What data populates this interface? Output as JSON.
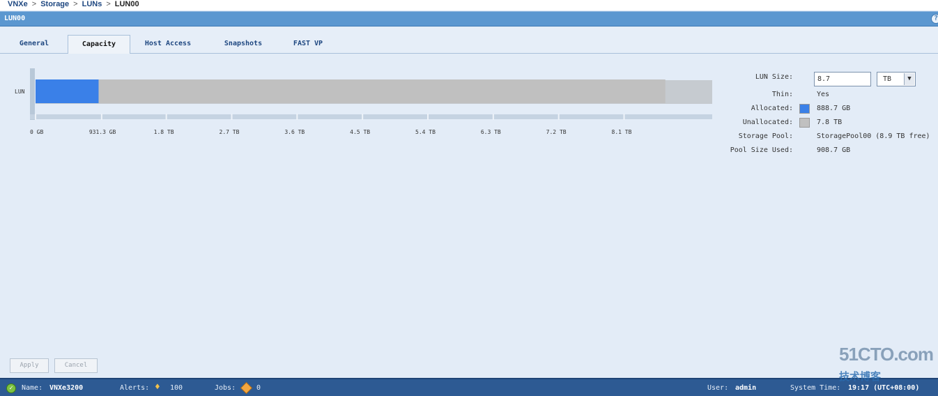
{
  "breadcrumb": {
    "items": [
      "VNXe",
      "Storage",
      "LUNs"
    ],
    "current": "LUN00",
    "separator": ">"
  },
  "window": {
    "title": "LUN00",
    "help_icon": "help-icon"
  },
  "tabs": [
    {
      "label": "General",
      "active": false
    },
    {
      "label": "Capacity",
      "active": true
    },
    {
      "label": "Host Access",
      "active": false
    },
    {
      "label": "Snapshots",
      "active": false
    },
    {
      "label": "FAST VP",
      "active": false
    }
  ],
  "chart_data": {
    "type": "bar",
    "orientation": "horizontal",
    "stacked": true,
    "categories": [
      "LUN"
    ],
    "series": [
      {
        "name": "Allocated",
        "values": [
          888.7
        ],
        "color": "#3a80e8"
      },
      {
        "name": "Unallocated",
        "values": [
          7987.3
        ],
        "color": "#c0c0c0"
      }
    ],
    "units": "GB",
    "xlim": [
      0,
      9536.7
    ],
    "ticks": [
      {
        "value": 0,
        "label": "0 GB"
      },
      {
        "value": 931.3,
        "label": "931.3 GB"
      },
      {
        "value": 1843.2,
        "label": "1.8 TB"
      },
      {
        "value": 2764.8,
        "label": "2.7 TB"
      },
      {
        "value": 3686.4,
        "label": "3.6 TB"
      },
      {
        "value": 4608,
        "label": "4.5 TB"
      },
      {
        "value": 5529.6,
        "label": "5.4 TB"
      },
      {
        "value": 6451.2,
        "label": "6.3 TB"
      },
      {
        "value": 7372.8,
        "label": "7.2 TB"
      },
      {
        "value": 8294.4,
        "label": "8.1 TB"
      }
    ],
    "grid": false
  },
  "properties": {
    "lun_size_label": "LUN Size:",
    "lun_size_value": "8.7",
    "lun_size_unit": "TB",
    "thin_label": "Thin:",
    "thin_value": "Yes",
    "allocated_label": "Allocated:",
    "allocated_value": "888.7 GB",
    "unallocated_label": "Unallocated:",
    "unallocated_value": "7.8 TB",
    "storage_pool_label": "Storage Pool:",
    "storage_pool_value": "StoragePool00 (8.9 TB free)",
    "pool_size_used_label": "Pool Size Used:",
    "pool_size_used_value": "908.7 GB"
  },
  "actions": {
    "apply_label": "Apply",
    "cancel_label": "Cancel"
  },
  "status": {
    "name_label": "Name:",
    "name_value": "VNXe3200",
    "alerts_label": "Alerts:",
    "alerts_value": "100",
    "jobs_label": "Jobs:",
    "jobs_value": "0",
    "user_label": "User:",
    "user_value": "admin",
    "system_time_label": "System Time:",
    "system_time_value": "19:17 (UTC+08:00)"
  },
  "watermark": {
    "line1": "51CTO.com",
    "line2": "技术博客"
  }
}
